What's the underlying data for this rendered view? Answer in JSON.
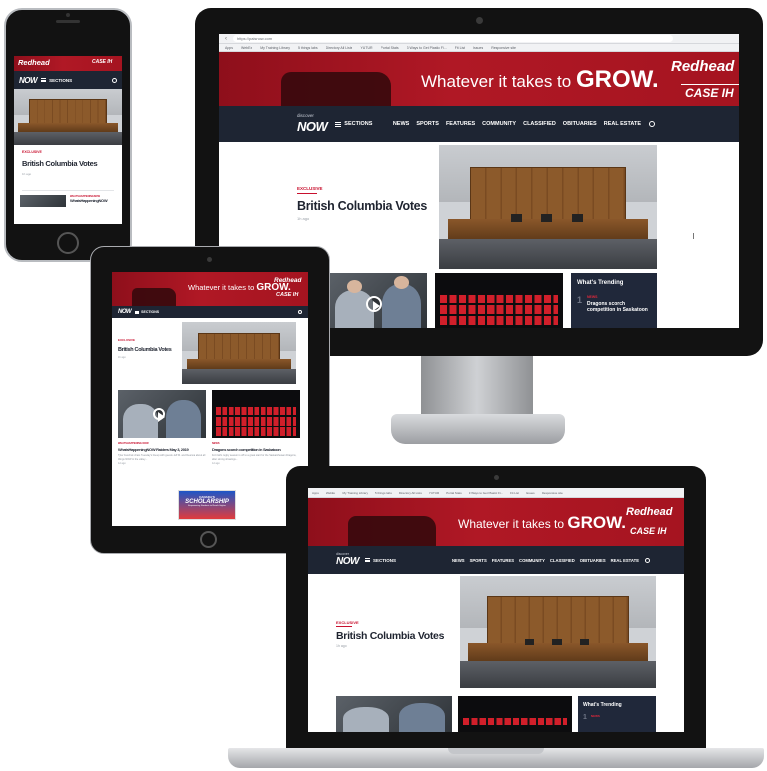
{
  "site": {
    "url": "https://paisnow.com",
    "bookmarks": [
      "Apps",
      "WebEx",
      "My Training Library",
      "5 things labs",
      "Directory All Lists",
      "YUTUR",
      "Portal Stats",
      "3 Ways to Get Plastic Fi...",
      "Fit List",
      "Issues",
      "Responsive site"
    ],
    "banner": {
      "slogan_prefix": "Whatever it takes to ",
      "slogan_emph": "GROW.",
      "brand": "Redhead",
      "brand_suffix": "EQUIPMENT",
      "case_brand": "CASE IH",
      "case_sub": "AGRICULTURE"
    },
    "logo": "NOW",
    "logo_small": "discover",
    "sections_label": "SECTIONS",
    "nav": [
      "NEWS",
      "SPORTS",
      "FEATURES",
      "COMMUNITY",
      "CLASSIFIED",
      "OBITUARIES",
      "REAL ESTATE"
    ]
  },
  "hero": {
    "kicker": "EXCLUSIVE",
    "headline": "British Columbia Votes",
    "meta": "1h ago"
  },
  "trending": {
    "title": "What's Trending",
    "number": "1",
    "kicker": "NEWS",
    "headline": "Dragons scorch competition in Saskatoon"
  },
  "phone": {
    "teaser_kicker": "WHATSHAPPENINGNOW",
    "teaser_title": "WhatsHappeningNOW"
  },
  "tablet": {
    "card1": {
      "kicker": "WHATSHAPPENING NOW",
      "title": "WhatsHappeningNOW Raiders May 3, 2019",
      "text": "Tyler Feschuk chats Tuesday's lineup with guests Jeff M. and Deanna about all things NOW in the valley...",
      "meta": "1d ago"
    },
    "card2": {
      "kicker": "NEWS",
      "title": "Dragons scorch competition in Saskatoon",
      "text": "Fort Girls rugby season is off to a great start for the Saskatchewan Dragons, after strong showings...",
      "meta": "1d ago"
    },
    "ad": {
      "line1": "CANADA'S",
      "line2": "SCHOLARSHIP",
      "line3": "Empowering Students to Reach Higher"
    }
  },
  "colors": {
    "accent_red": "#c8102e",
    "banner_red": "#a51420",
    "navy": "#1e2533"
  }
}
